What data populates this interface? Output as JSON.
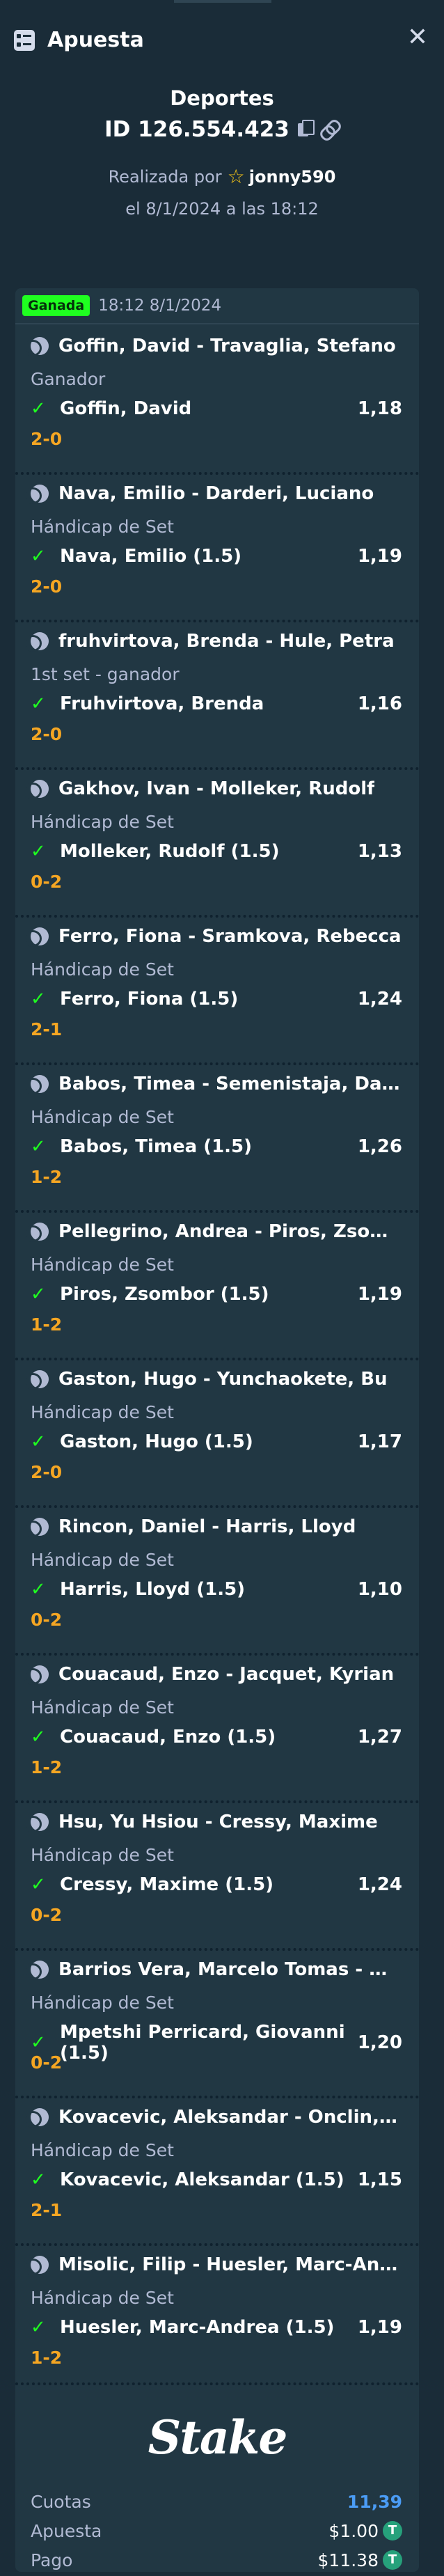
{
  "header": {
    "title": "Apuesta"
  },
  "bet": {
    "sport": "Deportes",
    "id": "ID 126.554.423",
    "placed_by_prefix": "Realizada por",
    "username": "jonny590",
    "placed_date": "el 8/1/2024 a las 18:12"
  },
  "card": {
    "status": "Ganada",
    "time": "18:12 8/1/2024",
    "legs": [
      {
        "event": "Goffin, David - Travaglia, Stefano",
        "market": "Ganador",
        "selection": "Goffin, David",
        "odds": "1,18",
        "score": "2-0"
      },
      {
        "event": "Nava, Emilio - Darderi, Luciano",
        "market": "Hándicap de Set",
        "selection": "Nava, Emilio (1.5)",
        "odds": "1,19",
        "score": "2-0"
      },
      {
        "event": "fruhvirtova, Brenda - Hule, Petra",
        "market": "1st set - ganador",
        "selection": "Fruhvirtova, Brenda",
        "odds": "1,16",
        "score": "2-0"
      },
      {
        "event": "Gakhov, Ivan - Molleker, Rudolf",
        "market": "Hándicap de Set",
        "selection": "Molleker, Rudolf (1.5)",
        "odds": "1,13",
        "score": "0-2"
      },
      {
        "event": "Ferro, Fiona - Sramkova, Rebecca",
        "market": "Hándicap de Set",
        "selection": "Ferro, Fiona (1.5)",
        "odds": "1,24",
        "score": "2-1"
      },
      {
        "event": "Babos, Timea - Semenistaja, Darja",
        "market": "Hándicap de Set",
        "selection": "Babos, Timea (1.5)",
        "odds": "1,26",
        "score": "1-2"
      },
      {
        "event": "Pellegrino, Andrea - Piros, Zsombor",
        "market": "Hándicap de Set",
        "selection": "Piros, Zsombor (1.5)",
        "odds": "1,19",
        "score": "1-2"
      },
      {
        "event": "Gaston, Hugo - Yunchaokete, Bu",
        "market": "Hándicap de Set",
        "selection": "Gaston, Hugo (1.5)",
        "odds": "1,17",
        "score": "2-0"
      },
      {
        "event": "Rincon, Daniel - Harris, Lloyd",
        "market": "Hándicap de Set",
        "selection": "Harris, Lloyd (1.5)",
        "odds": "1,10",
        "score": "0-2"
      },
      {
        "event": "Couacaud, Enzo - Jacquet, Kyrian",
        "market": "Hándicap de Set",
        "selection": "Couacaud, Enzo (1.5)",
        "odds": "1,27",
        "score": "1-2"
      },
      {
        "event": "Hsu, Yu Hsiou - Cressy, Maxime",
        "market": "Hándicap de Set",
        "selection": "Cressy, Maxime (1.5)",
        "odds": "1,24",
        "score": "0-2"
      },
      {
        "event": "Barrios Vera, Marcelo Tomas - Mpetshi Perricard, Giovanni",
        "market": "Hándicap de Set",
        "selection": "Mpetshi Perricard, Giovanni (1.5)",
        "odds": "1,20",
        "score": "0-2"
      },
      {
        "event": "Kovacevic, Aleksandar - Onclin, Gauthier",
        "market": "Hándicap de Set",
        "selection": "Kovacevic, Aleksandar (1.5)",
        "odds": "1,15",
        "score": "2-1"
      },
      {
        "event": "Misolic, Filip - Huesler, Marc-Andrea",
        "market": "Hándicap de Set",
        "selection": "Huesler, Marc-Andrea (1.5)",
        "odds": "1,19",
        "score": "1-2"
      }
    ]
  },
  "footer": {
    "logo": "Stake",
    "odds_label": "Cuotas",
    "odds_value": "11,39",
    "stake_label": "Apuesta",
    "stake_value": "$1.00",
    "payout_label": "Pago",
    "payout_value": "$11.38",
    "currency_symbol": "T"
  },
  "colors": {
    "background": "#1a2c38",
    "card": "#213743",
    "win_badge": "#1fff20",
    "score": "#f5a623",
    "odds_total": "#4b9cf5",
    "tether": "#26a17b"
  }
}
